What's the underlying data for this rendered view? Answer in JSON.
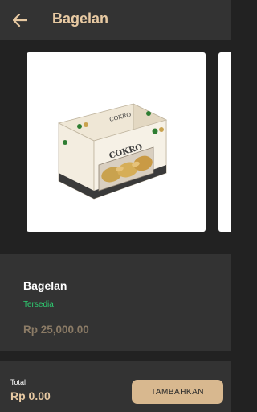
{
  "app_bar": {
    "title": "Bagelan",
    "back_icon": "arrow-left-icon"
  },
  "colors": {
    "accent": "#E7C9A2",
    "surface": "#333333",
    "background": "#222222",
    "status_green": "#2ECC71",
    "price_muted": "#8B7B66",
    "button": "#D8B88F"
  },
  "product": {
    "name": "Bagelan",
    "status": "Tersedia",
    "price": "Rp 25,000.00",
    "image_icon": "product-box-image",
    "box_brand": "COKRO"
  },
  "footer": {
    "total_label": "Total",
    "total_value": "Rp 0.00",
    "add_button_label": "TAMBAHKAN"
  }
}
